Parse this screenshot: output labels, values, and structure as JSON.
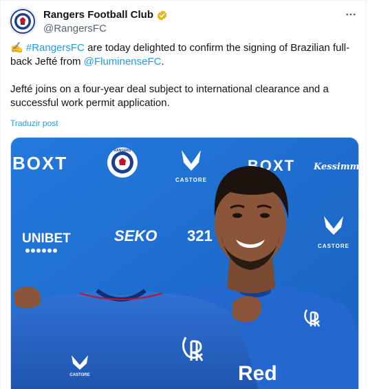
{
  "account": {
    "display_name": "Rangers Football Club",
    "handle": "@RangersFC",
    "avatar_icon": "rangers-crest-icon",
    "verified_color": "#e2b719"
  },
  "tweet": {
    "line1_emoji": "✍️",
    "line1_hashtag": "#RangersFC",
    "line1_text": " are today delighted to confirm the signing of Brazilian full-back Jefté from ",
    "line1_mention": "@FluminenseFC",
    "line1_end": ".",
    "paragraph2": "Jefté joins on a four-year deal subject to international clearance and a successful work permit application.",
    "translate_label": "Traduzir post"
  },
  "media": {
    "board_texts": {
      "boxt_left": "BOXT",
      "boxt_right": "BOXT",
      "castore_top": "CASTORE",
      "castore_right": "CASTORE",
      "castore_shirt": "CASTORE",
      "unibet": "UNIBET",
      "seko": "SEKO",
      "n321": "321",
      "kessimmer": "Kessimmer",
      "crest_top": "RANGERS",
      "shirt_sponsor": "Red"
    },
    "colors": {
      "backdrop": "#1f6fd0",
      "shirt": "#2a66c8",
      "accent": "#ffffff"
    }
  }
}
